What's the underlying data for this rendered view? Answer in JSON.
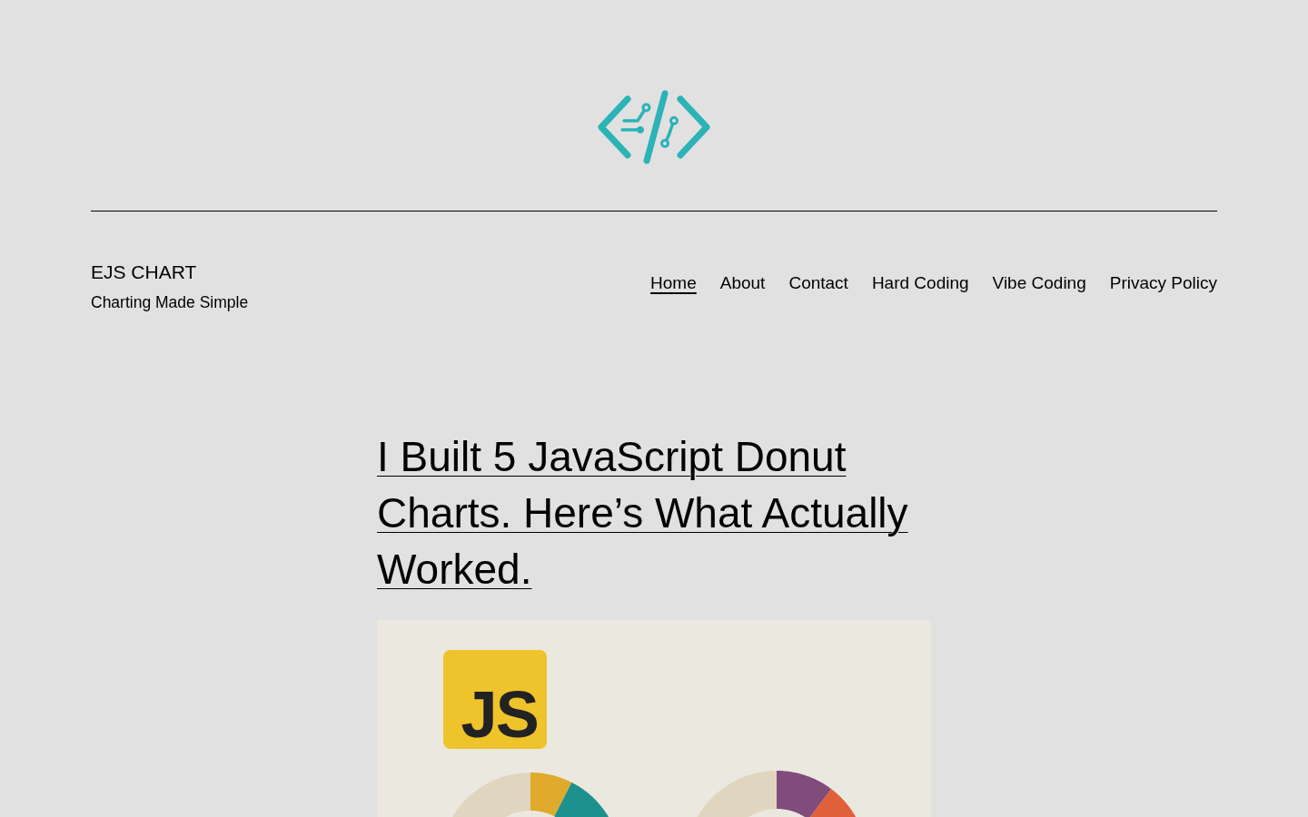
{
  "site": {
    "title": "EJS CHART",
    "tagline": "Charting Made Simple"
  },
  "nav": [
    {
      "label": "Home",
      "selected": true
    },
    {
      "label": "About",
      "selected": false
    },
    {
      "label": "Contact",
      "selected": false
    },
    {
      "label": "Hard Coding",
      "selected": false
    },
    {
      "label": "Vibe Coding",
      "selected": false
    },
    {
      "label": "Privacy Policy",
      "selected": false
    }
  ],
  "post": {
    "title": "I Built 5 JavaScript Donut Charts. Here’s What Actually Worked.",
    "featured_image": {
      "logo_text": "JS"
    }
  }
}
